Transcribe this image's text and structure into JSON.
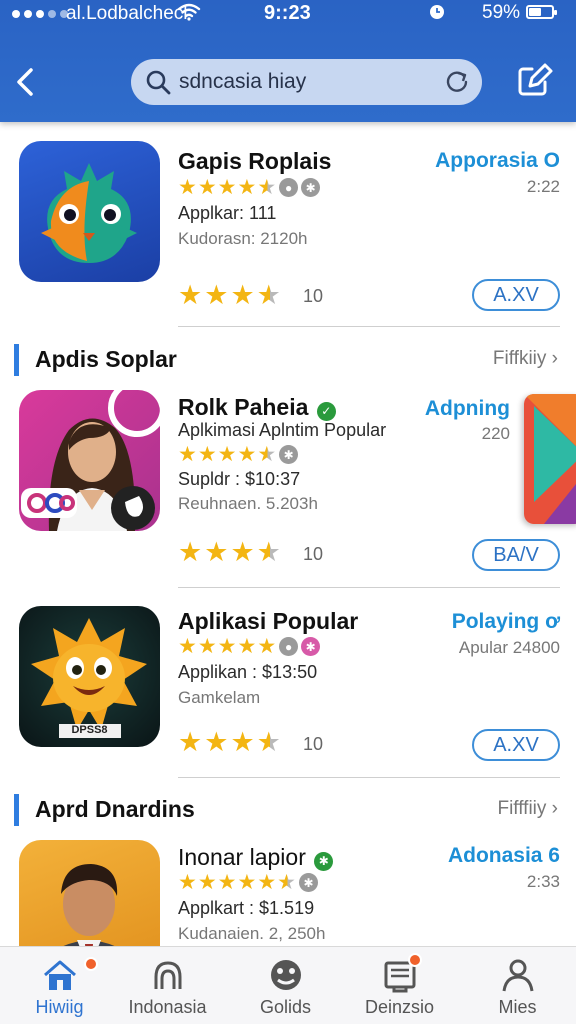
{
  "status_bar": {
    "carrier": "al.Lodbalchecl",
    "time": "9::23",
    "battery_percent": "59%"
  },
  "header": {
    "search_text": "sdncasia hiay"
  },
  "apps": [
    {
      "name": "Gapis Roplais",
      "status": "Apporasia O",
      "meta": "2:22",
      "line1": "Applkar: 111",
      "line2": "Kudorasn: 2120h",
      "count": "10",
      "action": "A.XV",
      "icon": "green-orange-bird-icon"
    },
    {
      "name": "Rolk Paheia",
      "status": "Adpning",
      "meta": "220",
      "line0": "Aplkimasi Aplntim Popular",
      "line1": "Supldr : $10:37",
      "line2": "Reuhnaen. 5.203h",
      "count": "10",
      "action": "BA/V",
      "icon": "woman-portrait-icon"
    },
    {
      "name": "Aplikasi Popular",
      "status": "Polaying ơ",
      "meta": "Apular 24800",
      "line1": "Applikan : $13:50",
      "line2": "Gamkelam",
      "count": "10",
      "action": "A.XV",
      "icon_caption": "DPSS8",
      "icon": "orange-star-creature-icon"
    },
    {
      "name": "Inonar lapior",
      "status": "Adonasia 6",
      "meta": "2:33",
      "line1": "Applkart : $1.519",
      "line2": "Kudanaien. 2, 250h",
      "icon": "man-portrait-icon"
    }
  ],
  "sections": [
    {
      "title": "Apdis Soplar",
      "more": "Fiffkiiy"
    },
    {
      "title": "Aprd Dnardins",
      "more": "Fifffiiy"
    }
  ],
  "bottom_nav": [
    {
      "label": "Hiwiig",
      "icon": "home-icon",
      "active": true
    },
    {
      "label": "Indonasia",
      "icon": "cloud-icon",
      "active": false
    },
    {
      "label": "Golids",
      "icon": "gamepad-icon",
      "active": false
    },
    {
      "label": "Deinzsio",
      "icon": "inbox-icon",
      "active": false
    },
    {
      "label": "Mies",
      "icon": "person-icon",
      "active": false
    }
  ],
  "colors": {
    "header_blue": "#2f6ccb",
    "accent_blue": "#1d8fd6",
    "star_gold": "#f3b513",
    "badge_orange": "#f0612b"
  }
}
